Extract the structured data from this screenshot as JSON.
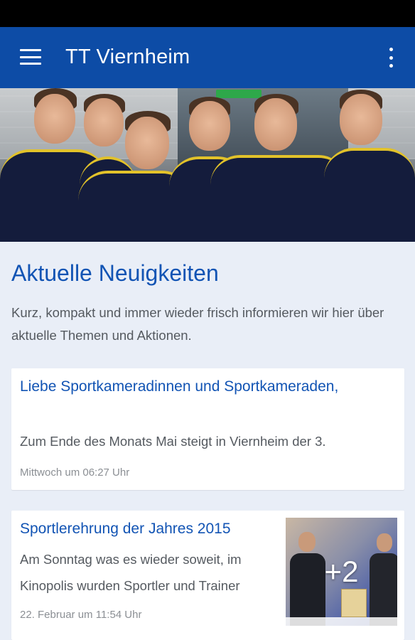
{
  "app_bar": {
    "title": "TT Viernheim",
    "menu_icon": "hamburger-menu-icon",
    "overflow_icon": "more-vert-icon",
    "color": "#0d4ca6"
  },
  "hero": {
    "image": "team-photo"
  },
  "news": {
    "title": "Aktuelle Neuigkeiten",
    "intro": "Kurz, kompakt und immer wieder frisch informieren wir hier über aktuelle Themen und Aktionen.",
    "items": [
      {
        "title": "Liebe Sportkameradinnen und Sportkameraden,",
        "snippet": "Zum Ende des Monats Mai steigt in Viernheim der 3.",
        "date": "Mittwoch um 06:27 Uhr"
      },
      {
        "title": "Sportlerehrung der Jahres 2015",
        "snippet": "Am Sonntag was es wieder soweit, im Kinopolis wurden Sportler und Trainer",
        "date": "22. Februar um 11:54 Uhr",
        "thumbnail_extra_count": "+2"
      }
    ]
  },
  "colors": {
    "accent": "#1254b4",
    "background": "#e9eef7",
    "text": "#555a60",
    "muted": "#8b8f94"
  }
}
